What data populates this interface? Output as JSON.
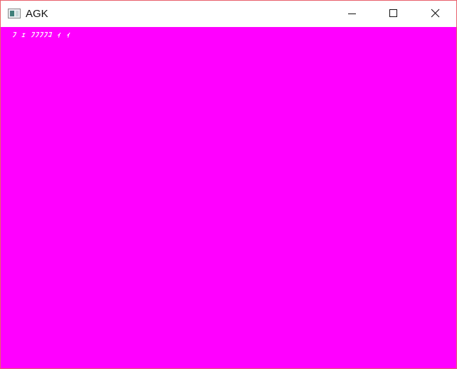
{
  "window": {
    "title": "AGK",
    "app_icon": "window-app-icon",
    "controls": {
      "minimize_icon": "minimize-icon",
      "maximize_icon": "maximize-icon",
      "close_icon": "close-icon"
    },
    "border_color": "#e8606c"
  },
  "canvas": {
    "background_color": "#ff00ff",
    "overlay_text": "ﾌ ｪ ﾌﾌﾌﾌｺ ｨ ｨ"
  }
}
